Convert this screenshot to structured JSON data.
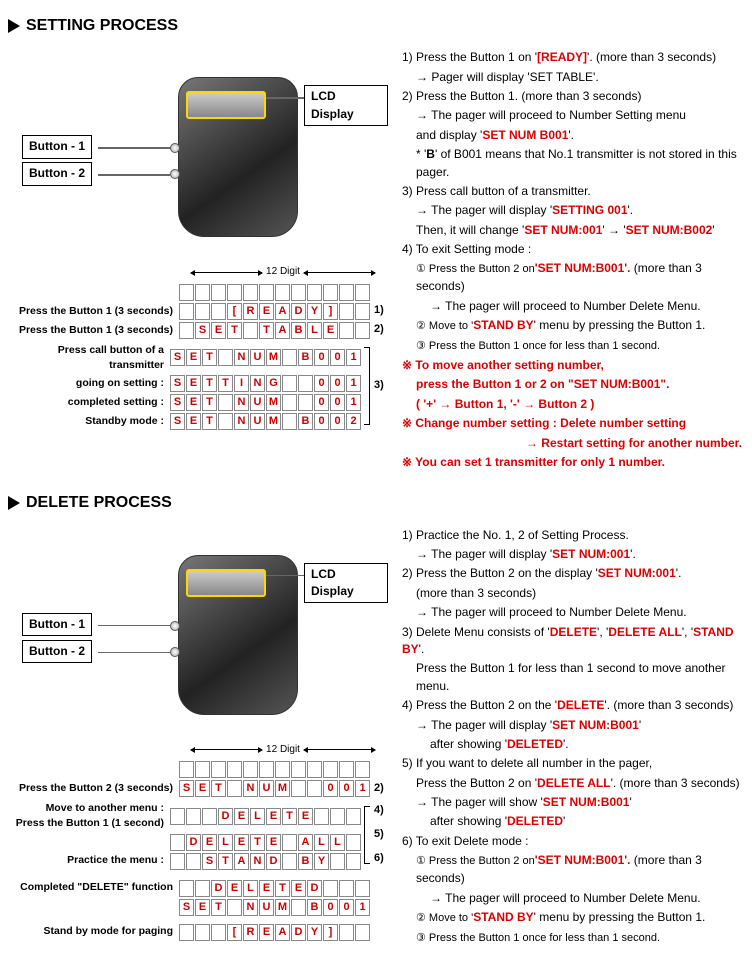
{
  "sections": {
    "setting": {
      "title": "SETTING PROCESS"
    },
    "delete": {
      "title": "DELETE PROCESS"
    }
  },
  "common": {
    "lcd_display": "LCD Display",
    "button1": "Button - 1",
    "button2": "Button - 2",
    "digit_label": "12 Digit"
  },
  "setting_rows": {
    "r0_label": "",
    "r1_label": "Press the Button 1 (3 seconds)",
    "r2_label": "Press the Button 1 (3 seconds)",
    "r3_label": "Press call button of a transmitter",
    "r4_label": "going on setting :",
    "r5_label": "completed setting :",
    "r6_label": "Standby mode :",
    "r1_num": "1)",
    "r2_num": "2)",
    "r3_num": "3)"
  },
  "setting_cells": {
    "r1": [
      "",
      "",
      "",
      "[",
      "R",
      "E",
      "A",
      "D",
      "Y",
      "]",
      "",
      ""
    ],
    "r2": [
      "",
      "S",
      "E",
      "T",
      "",
      "T",
      "A",
      "B",
      "L",
      "E",
      "",
      ""
    ],
    "r3": [
      "S",
      "E",
      "T",
      "",
      "N",
      "U",
      "M",
      "",
      "B",
      "0",
      "0",
      "1"
    ],
    "r4": [
      "S",
      "E",
      "T",
      "T",
      "I",
      "N",
      "G",
      "",
      "",
      "0",
      "0",
      "1"
    ],
    "r5": [
      "S",
      "E",
      "T",
      "",
      "N",
      "U",
      "M",
      "",
      "",
      "0",
      "0",
      "1"
    ],
    "r6": [
      "S",
      "E",
      "T",
      "",
      "N",
      "U",
      "M",
      "",
      "B",
      "0",
      "0",
      "2"
    ]
  },
  "delete_rows": {
    "r1_label": "Press the Button 2 (3 seconds)",
    "r2_label": "Move to another menu :",
    "r2b_label": "Press the Button 1 (1 second)",
    "r3_label": "Practice the menu :",
    "r4_label": "Completed \"DELETE\" function",
    "r5_label": "Stand by mode for paging",
    "n2": "2)",
    "n4": "4)",
    "n5": "5)",
    "n6": "6)"
  },
  "delete_cells": {
    "r1": [
      "S",
      "E",
      "T",
      "",
      "N",
      "U",
      "M",
      "",
      "",
      "0",
      "0",
      "1"
    ],
    "r2": [
      "",
      "",
      "",
      "D",
      "E",
      "L",
      "E",
      "T",
      "E",
      "",
      "",
      ""
    ],
    "r3": [
      "",
      "D",
      "E",
      "L",
      "E",
      "T",
      "E",
      "",
      "A",
      "L",
      "L",
      ""
    ],
    "r4": [
      "",
      "",
      "S",
      "T",
      "A",
      "N",
      "D",
      "",
      "B",
      "Y",
      "",
      ""
    ],
    "r5": [
      "",
      "",
      "D",
      "E",
      "L",
      "E",
      "T",
      "E",
      "D",
      "",
      "",
      ""
    ],
    "r6": [
      "S",
      "E",
      "T",
      "",
      "N",
      "U",
      "M",
      "",
      "B",
      "0",
      "0",
      "1"
    ],
    "r7": [
      "",
      "",
      "",
      "[",
      "R",
      "E",
      "A",
      "D",
      "Y",
      "]",
      "",
      ""
    ]
  },
  "right_setting": {
    "p1a": "1) Press the Button 1 on '",
    "p1b": "[READY]",
    "p1c": "'. (more than 3 seconds)",
    "p1d": "→ Pager will display 'SET TABLE'.",
    "p2a": "2) Press the Button 1. (more than 3 seconds)",
    "p2b": "→ The pager will proceed to Number Setting menu",
    "p2c": "and display '",
    "p2d": "SET NUM B001",
    "p2e": "'.",
    "p2f": "* '",
    "p2g": "B",
    "p2h": "' of B001 means that No.1 transmitter is not stored in this pager.",
    "p3a": "3) Press call button of a transmitter.",
    "p3b": "→ The pager will display '",
    "p3c": "SETTING 001",
    "p3d": "'.",
    "p3e": "Then, it will change '",
    "p3f": "SET NUM:001",
    "p3g": "' → '",
    "p3h": "SET NUM:B002",
    "p3i": "'",
    "p4a": "4) To exit Setting mode :",
    "p4b": "① Press the Button 2 on ",
    "p4c": "'SET NUM:B001'.",
    "p4d": " (more than 3 seconds)",
    "p4e": "→ The pager will proceed to Number Delete Menu.",
    "p4f": "② Move to '",
    "p4g": "STAND BY",
    "p4h": "' menu by pressing the Button 1.",
    "p4i": "③ Press the Button 1 once for less than 1 second.",
    "p5a": "※ To move another setting number,",
    "p5b": "press the Button 1 or 2 on \"SET NUM:B001\".",
    "p5c": "( '+' → Button 1, '-' → Button 2 )",
    "p5d": "※ Change number setting : Delete number setting",
    "p5e": "→ Restart setting for another number.",
    "p5f": "※ You can set 1 transmitter for only 1 number."
  },
  "right_delete": {
    "p1a": "1) Practice the No. 1, 2 of Setting Process.",
    "p1b": "→ The pager will display '",
    "p1c": "SET NUM:001",
    "p1d": "'.",
    "p2a": "2) Press the Button 2 on the display '",
    "p2b": "SET NUM:001",
    "p2c": "'.",
    "p2d": "(more than 3 seconds)",
    "p2e": "→ The pager will proceed to Number Delete Menu.",
    "p3a": "3) Delete Menu consists of '",
    "p3b": "DELETE",
    "p3c": "', '",
    "p3d": "DELETE ALL",
    "p3e": "', '",
    "p3f": "STAND BY",
    "p3g": "'.",
    "p3h": "Press the Button 1 for less than 1 second to move another menu.",
    "p4a": "4) Press the Button 2 on the '",
    "p4b": "DELETE",
    "p4c": "'. (more than 3 seconds)",
    "p4d": "→ The pager will display '",
    "p4e": "SET NUM:B001",
    "p4f": "'",
    "p4g": "after showing '",
    "p4h": "DELETED",
    "p4i": "'.",
    "p5a": "5) If you want to delete all number in the pager,",
    "p5b": "Press the Button 2 on '",
    "p5c": "DELETE ALL",
    "p5d": "'. (more than 3 seconds)",
    "p5e": "→ The pager will show '",
    "p5f": "SET NUM:B001",
    "p5g": "'",
    "p5h": "after showing '",
    "p5i": "DELETED",
    "p5j": "'",
    "p6a": "6) To exit Delete mode :",
    "p6b": "① Press the Button 2 on ",
    "p6c": "'SET NUM:B001'.",
    "p6d": " (more than 3 seconds)",
    "p6e": "→ The pager will proceed to Number Delete Menu.",
    "p6f": "② Move to '",
    "p6g": "STAND BY",
    "p6h": "' menu by pressing the Button 1.",
    "p6i": "③ Press the Button 1 once for less than 1 second."
  }
}
